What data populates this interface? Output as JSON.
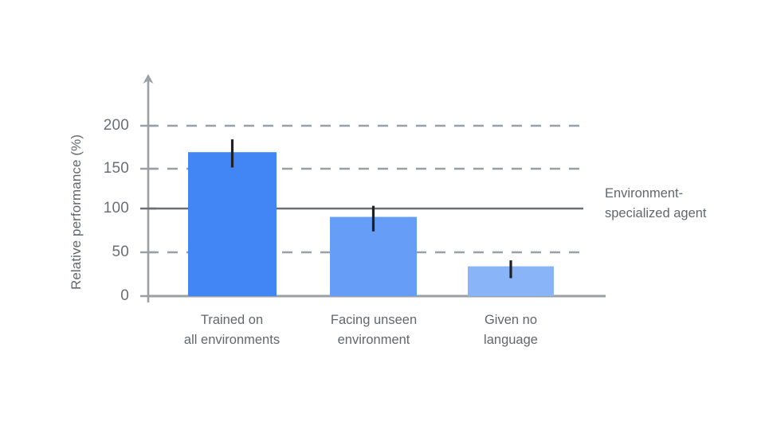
{
  "chart_data": {
    "type": "bar",
    "title": "",
    "subtitle": "",
    "xlabel": "",
    "ylabel": "Relative performance (%)",
    "categories": [
      "Trained on\nall environments",
      "Facing unseen\nenvironment",
      "Given no\nlanguage"
    ],
    "category_lines": [
      [
        "Trained on",
        "all environments"
      ],
      [
        "Facing unseen",
        "environment"
      ],
      [
        "Given no",
        "language"
      ]
    ],
    "values": [
      169,
      93,
      35
    ],
    "error_low": [
      151,
      76,
      21
    ],
    "error_high": [
      184,
      106,
      42
    ],
    "bar_colors": [
      "#4285f4",
      "#669df6",
      "#8ab4f8"
    ],
    "ylim": [
      0,
      230
    ],
    "yticks": [
      0,
      50,
      100,
      150,
      200
    ],
    "ytick_labels": [
      "0",
      "50",
      "100",
      "150",
      "200"
    ],
    "gridlines": {
      "dashed_at": [
        50,
        150,
        200
      ],
      "solid_at": [
        100
      ],
      "grid_color": "#9aa0a6",
      "solid_color": "#6b6f73"
    },
    "reference_line": {
      "value": 100,
      "label_lines": [
        "Environment-",
        "specialized agent"
      ]
    },
    "legend": null,
    "legend_position": "none",
    "axis_color": "#9aa0a6",
    "error_bar_color": "#202124",
    "background": "#ffffff"
  },
  "axis": {
    "y_title": "Relative performance (%)",
    "tick_0": "0",
    "tick_50": "50",
    "tick_100": "100",
    "tick_150": "150",
    "tick_200": "200"
  },
  "annotation": {
    "line1": "Environment-",
    "line2": "specialized agent"
  },
  "categories": {
    "cat0_line1": "Trained on",
    "cat0_line2": "all environments",
    "cat1_line1": "Facing unseen",
    "cat1_line2": "environment",
    "cat2_line1": "Given no",
    "cat2_line2": "language"
  }
}
